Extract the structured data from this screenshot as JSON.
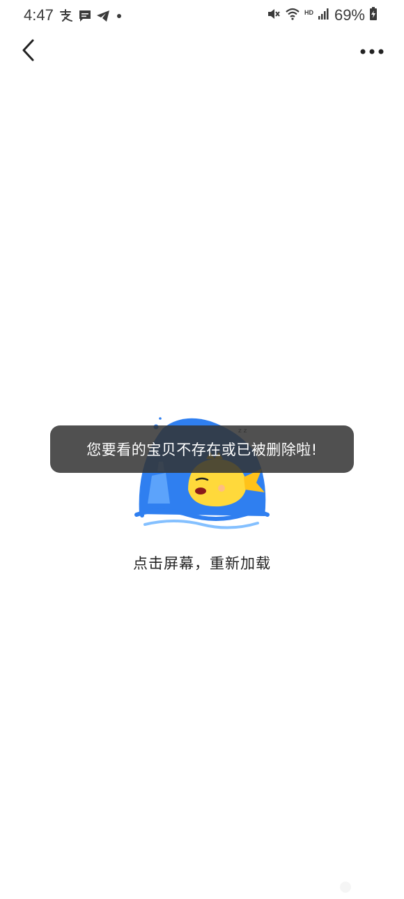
{
  "status_bar": {
    "time": "4:47",
    "battery": "69%",
    "network_badge": "HD",
    "left_icons": [
      "alipay-icon",
      "message-icon",
      "telegram-icon",
      "dot-icon"
    ],
    "right_icons": [
      "mute-icon",
      "wifi-icon",
      "signal-icon",
      "battery-charging-icon"
    ]
  },
  "nav": {
    "back_icon": "chevron-left-icon",
    "more_icon": "more-dots-icon"
  },
  "toast": {
    "message": "您要看的宝贝不存在或已被删除啦!"
  },
  "content": {
    "reload_label": "点击屏幕，重新加载"
  },
  "colors": {
    "illustration_blue": "#2f7ff0",
    "fish_yellow": "#ffd93b",
    "toast_bg": "#333333"
  }
}
